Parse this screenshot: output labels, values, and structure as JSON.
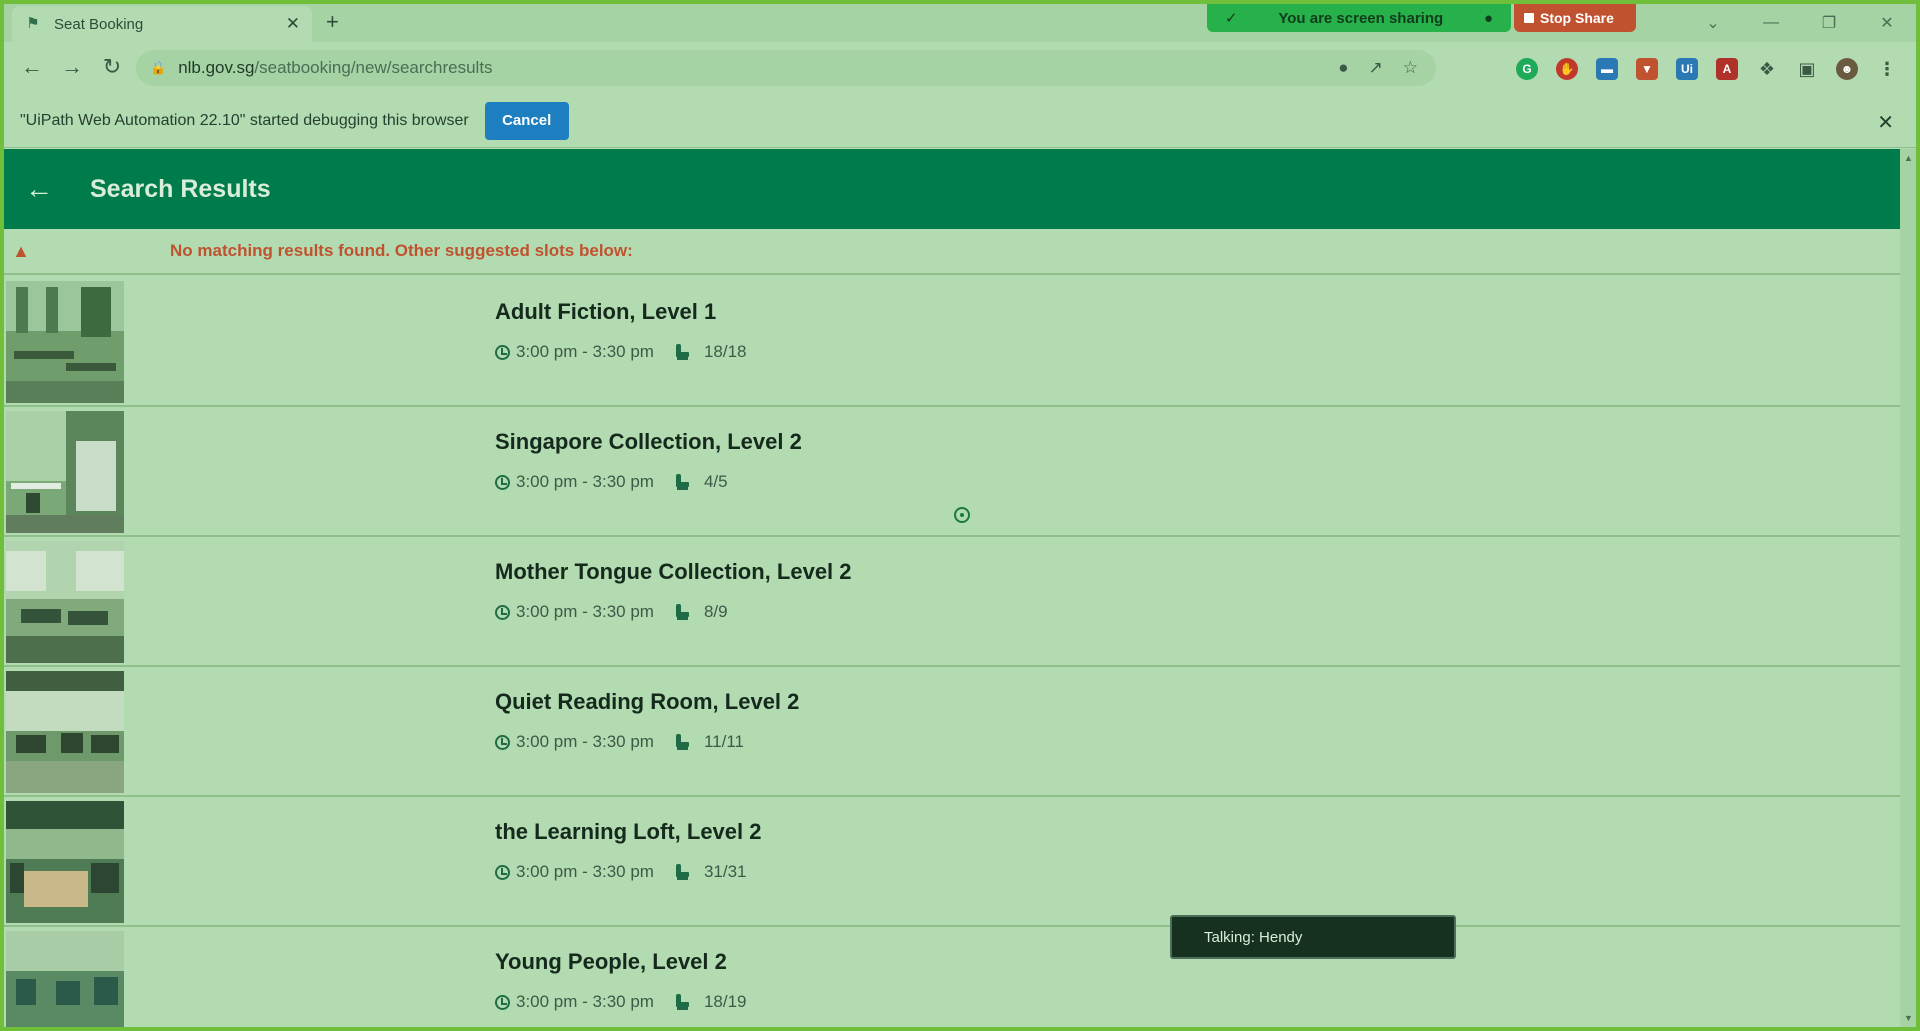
{
  "browser": {
    "tab_title": "Seat Booking",
    "url_host": "nlb.gov.sg",
    "url_path": "/seatbooking/new/searchresults",
    "share_text": "You are screen sharing",
    "stop_share_label": "Stop Share"
  },
  "debug_bar": {
    "message": "\"UiPath Web Automation 22.10\" started debugging this browser",
    "cancel_label": "Cancel"
  },
  "header": {
    "title": "Search Results"
  },
  "warning": {
    "text": "No matching results found. Other suggested slots below:"
  },
  "results": [
    {
      "name": "Adult Fiction, Level 1",
      "time": "3:00 pm - 3:30 pm",
      "seats": "18/18"
    },
    {
      "name": "Singapore Collection, Level 2",
      "time": "3:00 pm - 3:30 pm",
      "seats": "4/5"
    },
    {
      "name": "Mother Tongue Collection, Level 2",
      "time": "3:00 pm - 3:30 pm",
      "seats": "8/9"
    },
    {
      "name": "Quiet Reading Room, Level 2",
      "time": "3:00 pm - 3:30 pm",
      "seats": "11/11"
    },
    {
      "name": "the Learning Loft, Level 2",
      "time": "3:00 pm - 3:30 pm",
      "seats": "31/31"
    },
    {
      "name": "Young People, Level 2",
      "time": "3:00 pm - 3:30 pm",
      "seats": "18/19"
    }
  ],
  "toast": {
    "text": "Talking: Hendy"
  },
  "colors": {
    "header_bg": "#007b4c",
    "warning": "#c0522f",
    "accent_button": "#1d7fbf"
  }
}
